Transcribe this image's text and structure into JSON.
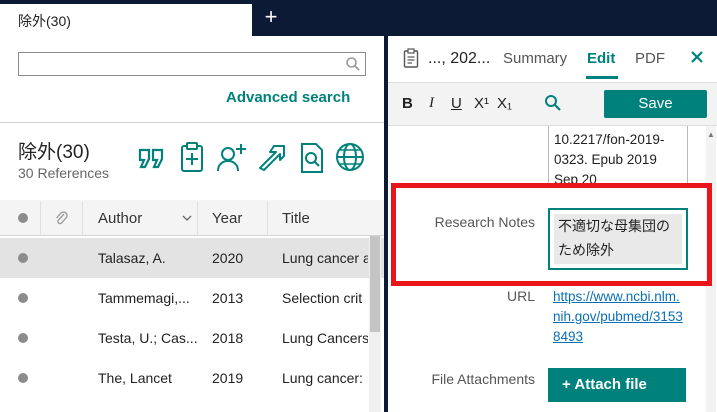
{
  "tabbar": {
    "tab_label": "除外(30)",
    "new_tab": "+"
  },
  "left": {
    "search": {
      "value": "",
      "placeholder": ""
    },
    "advanced_search": "Advanced search",
    "group_title": "除外(30)",
    "group_count": "30 References",
    "columns": {
      "author": "Author",
      "year": "Year",
      "title": "Title"
    },
    "rows": [
      {
        "author": "Talasaz, A.",
        "year": "2020",
        "title": "Lung cancer a",
        "selected": true
      },
      {
        "author": "Tammemagi,...",
        "year": "2013",
        "title": "Selection crit",
        "selected": false
      },
      {
        "author": "Testa, U.; Cas...",
        "year": "2018",
        "title": "Lung Cancers",
        "selected": false
      },
      {
        "author": "The, Lancet",
        "year": "2019",
        "title": "Lung cancer:",
        "selected": false
      }
    ]
  },
  "right": {
    "ref_title": "..., 202...",
    "tabs": {
      "summary": "Summary",
      "edit": "Edit",
      "pdf": "PDF"
    },
    "close": "✕",
    "format": {
      "bold": "B",
      "italic": "I",
      "underline": "U",
      "superscript": "X¹",
      "subscript": "X₁"
    },
    "save": "Save",
    "doi_text": "10.2217/fon-2019-0323. Epub 2019 Sep 20",
    "research_notes_label": "Research Notes",
    "research_notes_value": "不適切な母集団のため除外",
    "url_label": "URL",
    "url_value": "https://www.ncbi.nlm.nih.gov/pubmed/31538493",
    "file_attachments_label": "File Attachments",
    "attach_button": "+ Attach file"
  },
  "colors": {
    "accent": "#00817c",
    "highlight": "#e8161b",
    "chrome": "#0c1a36",
    "link": "#0a6fb5"
  }
}
